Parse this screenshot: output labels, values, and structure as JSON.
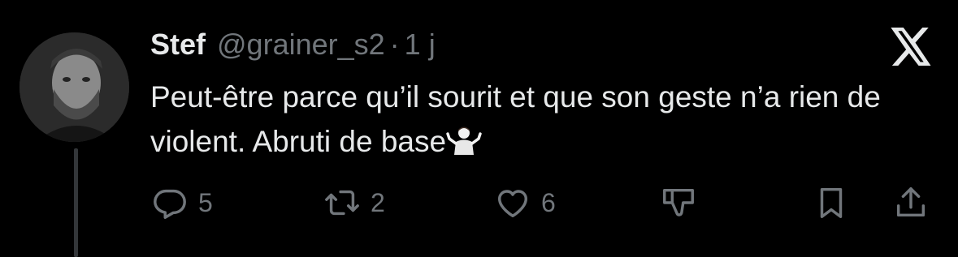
{
  "tweet": {
    "author_name": "Stef",
    "handle": "@grainer_s2",
    "separator": "·",
    "time": "1 j",
    "text": "Peut-être parce qu’il sourit et que son geste n’a rien de violent. Abruti de base",
    "emoji": "person-shrugging"
  },
  "actions": {
    "reply_count": "5",
    "retweet_count": "2",
    "like_count": "6"
  },
  "icons": [
    "x-logo-icon",
    "reply-icon",
    "retweet-icon",
    "like-icon",
    "dislike-icon",
    "bookmark-icon",
    "share-icon"
  ],
  "colors": {
    "background": "#000000",
    "primary_text": "#e7e9ea",
    "secondary_text": "#71767b",
    "thread_line": "#333639"
  }
}
